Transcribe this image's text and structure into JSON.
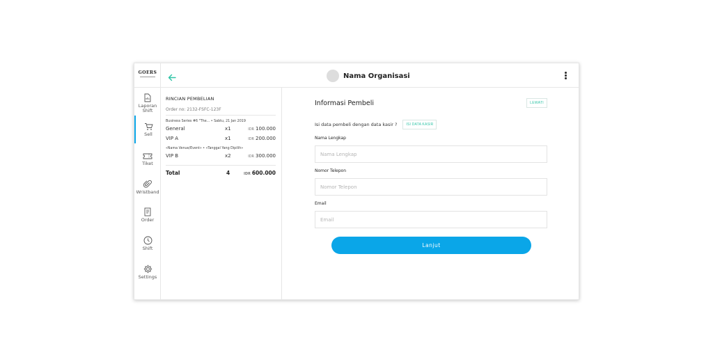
{
  "app": {
    "logo_text": "GOERS"
  },
  "sidebar": {
    "items": [
      {
        "label": "Laporan Shift",
        "icon": "report-icon"
      },
      {
        "label": "Sell",
        "icon": "cart-icon",
        "active": true
      },
      {
        "label": "Tiket",
        "icon": "ticket-icon"
      },
      {
        "label": "Wristband",
        "icon": "paperclip-icon"
      },
      {
        "label": "Order",
        "icon": "order-icon"
      },
      {
        "label": "Shift",
        "icon": "clock-icon"
      },
      {
        "label": "Settings",
        "icon": "gear-icon"
      }
    ]
  },
  "header": {
    "org_name": "Nama Organisasi",
    "accent": "#2ec4a6"
  },
  "order": {
    "title": "RINCIAN PEMBELIAN",
    "order_no": "Order no: 2132-FSFC-123F",
    "currency": "IDR",
    "groups": [
      {
        "event": "Business Series #6 \"The... • Sabtu, 21 Jan 2019",
        "items": [
          {
            "name": "General",
            "qty": "x1",
            "price": "100.000"
          },
          {
            "name": "VIP A",
            "qty": "x1",
            "price": "200.000"
          }
        ]
      },
      {
        "event": "«Nama Venue/Event» • «Tanggal Yang Dipilih»",
        "items": [
          {
            "name": "VIP B",
            "qty": "x2",
            "price": "300.000"
          }
        ]
      }
    ],
    "total": {
      "label": "Total",
      "qty": "4",
      "price": "600.000"
    }
  },
  "form": {
    "title": "Informasi Pembeli",
    "skip_label": "LEWATI",
    "ask_text": "Isi data pembeli dengan data kasir ?",
    "fill_label": "ISI DATA KASIR",
    "fields": {
      "name": {
        "label": "Nama Lengkap",
        "placeholder": "Nama Lengkap",
        "value": ""
      },
      "phone": {
        "label": "Nomor Telepon",
        "placeholder": "Nomor Telepon",
        "value": ""
      },
      "email": {
        "label": "Email",
        "placeholder": "Email",
        "value": ""
      }
    },
    "submit_label": "Lanjut",
    "primary_color": "#0aa6e8"
  }
}
